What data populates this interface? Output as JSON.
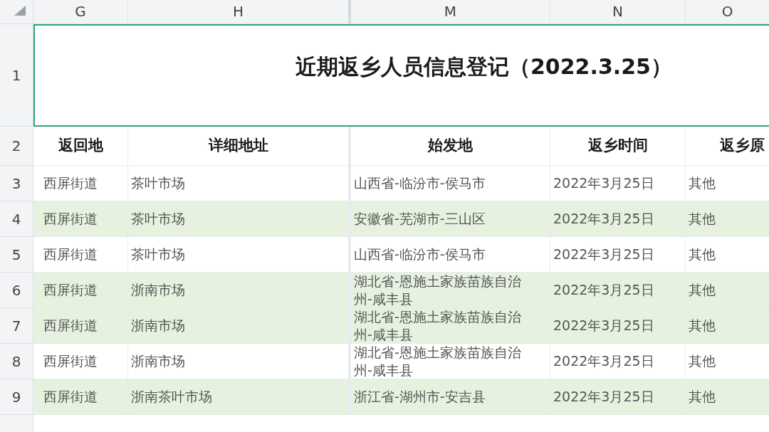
{
  "column_letters": [
    "G",
    "H",
    "M",
    "N",
    "O"
  ],
  "title_row": {
    "number": "1",
    "title": "近期返乡人员信息登记（2022.3.25）",
    "selected": true
  },
  "header_row": {
    "number": "2",
    "cells": [
      "返回地",
      "详细地址",
      "始发地",
      "返乡时间",
      "返乡原"
    ]
  },
  "rows": [
    {
      "number": "3",
      "highlighted": false,
      "cells": [
        "西屏街道",
        "茶叶市场",
        "山西省-临汾市-侯马市",
        "2022年3月25日",
        "其他"
      ]
    },
    {
      "number": "4",
      "highlighted": true,
      "cells": [
        "西屏街道",
        "茶叶市场",
        "安徽省-芜湖市-三山区",
        "2022年3月25日",
        "其他"
      ]
    },
    {
      "number": "5",
      "highlighted": false,
      "cells": [
        "西屏街道",
        "茶叶市场",
        "山西省-临汾市-侯马市",
        "2022年3月25日",
        "其他"
      ]
    },
    {
      "number": "6",
      "highlighted": true,
      "cells": [
        "西屏街道",
        "浙南市场",
        "湖北省-恩施土家族苗族自治州-咸丰县",
        "2022年3月25日",
        "其他"
      ]
    },
    {
      "number": "7",
      "highlighted": true,
      "cells": [
        "西屏街道",
        "浙南市场",
        "湖北省-恩施土家族苗族自治州-咸丰县",
        "2022年3月25日",
        "其他"
      ]
    },
    {
      "number": "8",
      "highlighted": false,
      "cells": [
        "西屏街道",
        "浙南市场",
        "湖北省-恩施土家族苗族自治州-咸丰县",
        "2022年3月25日",
        "其他"
      ]
    },
    {
      "number": "9",
      "highlighted": true,
      "cells": [
        "西屏街道",
        "浙南茶叶市场",
        "浙江省-湖州市-安吉县",
        "2022年3月25日",
        "其他"
      ]
    }
  ]
}
